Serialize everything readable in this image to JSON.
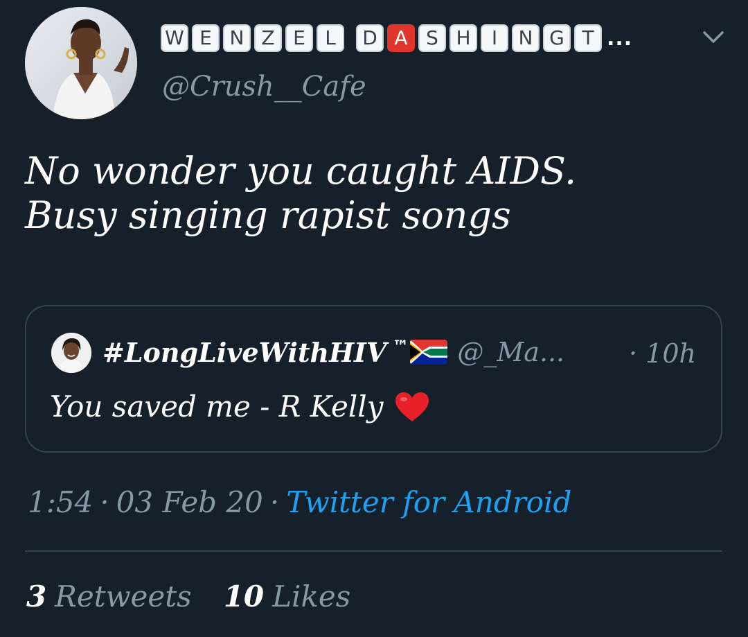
{
  "tweet": {
    "author": {
      "display_name_tiles_part1": [
        "W",
        "E",
        "N",
        "Z",
        "E",
        "L"
      ],
      "display_name_tiles_part2": [
        "D",
        "A",
        "S",
        "H",
        "I",
        "N",
        "G",
        "T"
      ],
      "display_name_truncation": "...",
      "handle": "@Crush__Cafe"
    },
    "text_lines": [
      "No wonder you caught AIDS.",
      "Busy singing rapist songs"
    ],
    "quote": {
      "name": "#LongLiveWithHIV",
      "tm": "™",
      "handle": "@_Ma...",
      "time": "· 10h",
      "text": "You saved me - R Kelly",
      "flag_icon": "south-africa-flag-icon",
      "heart_icon": "red-heart-icon"
    },
    "meta": {
      "time": "1:54",
      "date": "03 Feb 20",
      "source": "Twitter for Android",
      "separator": "·"
    },
    "stats": {
      "retweets_count": "3",
      "retweets_label": "Retweets",
      "likes_count": "10",
      "likes_label": "Likes"
    }
  },
  "colors": {
    "background": "#15202b",
    "secondary_text": "#8899a6",
    "link": "#1da1f2",
    "border": "#38444d",
    "red_tile": "#e0352b"
  }
}
